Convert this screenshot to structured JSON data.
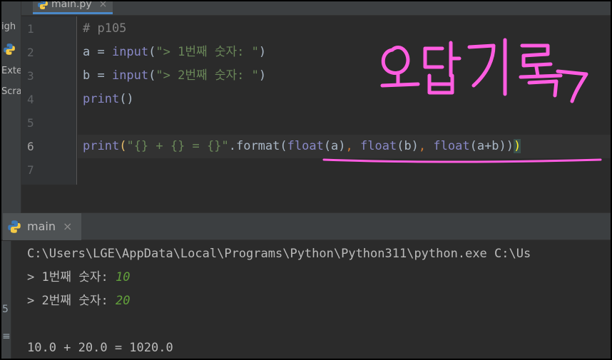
{
  "side_panel": {
    "labels": [
      "igh",
      "Exte",
      "Scra"
    ]
  },
  "editor": {
    "tab": {
      "label": "main.py",
      "close": "×",
      "icon": "python-file-icon"
    },
    "line_numbers": [
      "1",
      "2",
      "3",
      "4",
      "5",
      "6",
      "7"
    ],
    "line1": {
      "comment": "# p105"
    },
    "line2": {
      "a": "a = ",
      "fn": "input",
      "open": "(",
      "str": "\"> 1번째 숫자: \"",
      "close": ")"
    },
    "line3": {
      "a": "b = ",
      "fn": "input",
      "open": "(",
      "str": "\"> 2번째 숫자: \"",
      "close": ")"
    },
    "line4": {
      "fn": "print",
      "rest": "()"
    },
    "line6": {
      "fn": "print",
      "open": "(",
      "str": "\"{} + {} = {}\"",
      "dot": ".format(",
      "f1": "float",
      "a1": "(a)",
      "c1": ", ",
      "f2": "float",
      "a2": "(b)",
      "c2": ", ",
      "f3": "float",
      "a3": "(a+b)",
      "tail": ")",
      "last": ")"
    }
  },
  "run": {
    "tab": {
      "label": "main",
      "close": "×",
      "icon": "python-run-icon"
    },
    "rail": [
      "5",
      "≡"
    ],
    "console": {
      "cmd": "C:\\Users\\LGE\\AppData\\Local\\Programs\\Python\\Python311\\python.exe C:\\Us",
      "p1": "> 1번째 숫자: ",
      "v1": "10",
      "p2": "> 2번째 숫자: ",
      "v2": "20",
      "result": "10.0 + 20.0 = 1020.0"
    }
  },
  "annotation": {
    "text": "오답기록",
    "color": "#ff5ce1"
  },
  "colors": {
    "bg": "#2b2b2b",
    "keyword_orange": "#cc7832",
    "builtin_purple": "#8888c6",
    "string_green": "#6a8759",
    "input_green": "#62a03b",
    "comment_gray": "#808080",
    "bracket_match": "#ffef28"
  }
}
